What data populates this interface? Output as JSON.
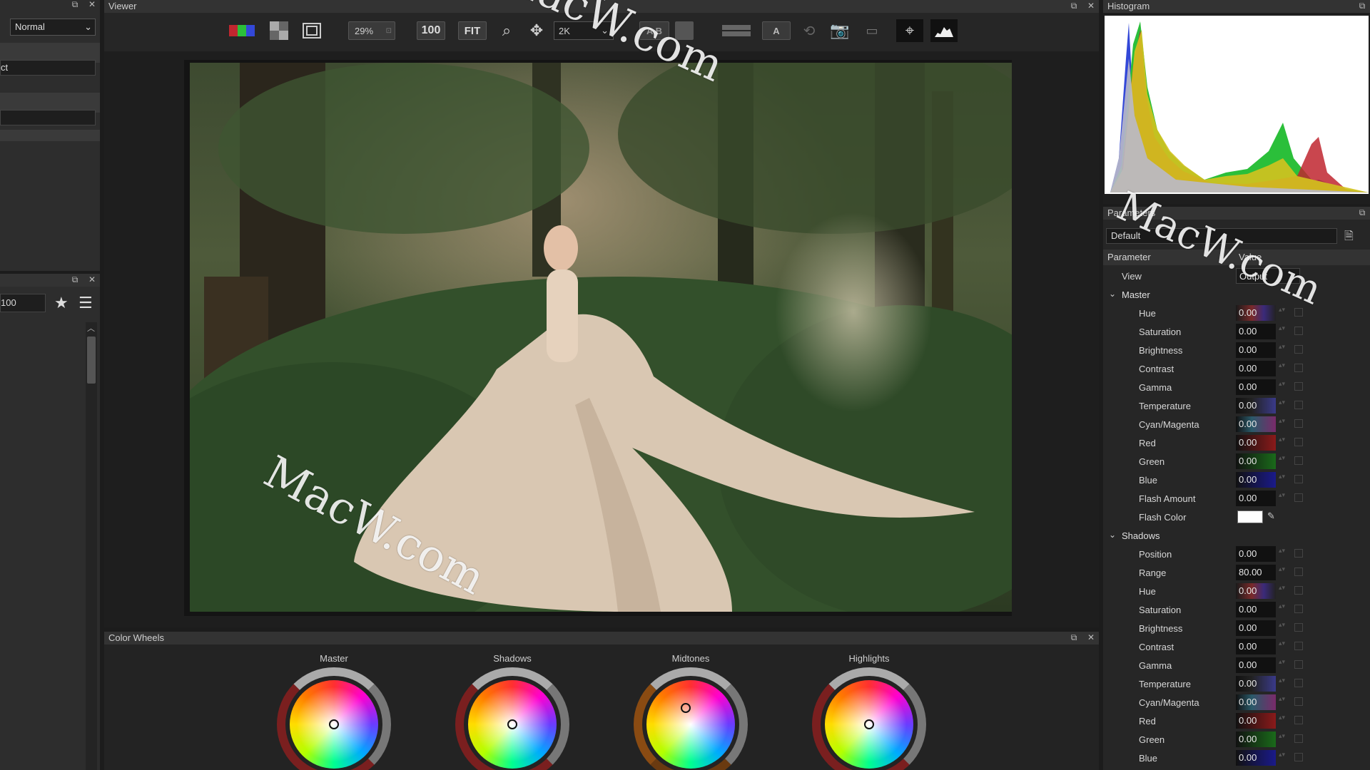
{
  "left_panel": {
    "blend_mode": "Normal",
    "field_text": "ct",
    "second_field": "",
    "rating_value": "100"
  },
  "viewer": {
    "title": "Viewer",
    "zoom": "29%",
    "btn_100": "100",
    "btn_fit": "FIT",
    "resolution": "2K",
    "ab_label": "A B",
    "a_label": "A"
  },
  "color_wheels": {
    "title": "Color Wheels",
    "wheels": [
      {
        "label": "Master"
      },
      {
        "label": "Shadows"
      },
      {
        "label": "Midtones"
      },
      {
        "label": "Highlights"
      }
    ]
  },
  "histogram": {
    "title": "Histogram"
  },
  "parameters": {
    "title": "Parameters",
    "preset": "Default",
    "col_parameter": "Parameter",
    "col_value": "Value",
    "view_label": "View",
    "view_value": "Output",
    "master_title": "Master",
    "master": [
      {
        "label": "Hue",
        "value": "0.00"
      },
      {
        "label": "Saturation",
        "value": "0.00"
      },
      {
        "label": "Brightness",
        "value": "0.00"
      },
      {
        "label": "Contrast",
        "value": "0.00"
      },
      {
        "label": "Gamma",
        "value": "0.00"
      },
      {
        "label": "Temperature",
        "value": "0.00"
      },
      {
        "label": "Cyan/Magenta",
        "value": "0.00"
      },
      {
        "label": "Red",
        "value": "0.00"
      },
      {
        "label": "Green",
        "value": "0.00"
      },
      {
        "label": "Blue",
        "value": "0.00"
      },
      {
        "label": "Flash Amount",
        "value": "0.00"
      }
    ],
    "flash_color_label": "Flash Color",
    "shadows_title": "Shadows",
    "shadows": [
      {
        "label": "Position",
        "value": "0.00"
      },
      {
        "label": "Range",
        "value": "80.00"
      },
      {
        "label": "Hue",
        "value": "0.00"
      },
      {
        "label": "Saturation",
        "value": "0.00"
      },
      {
        "label": "Brightness",
        "value": "0.00"
      },
      {
        "label": "Contrast",
        "value": "0.00"
      },
      {
        "label": "Gamma",
        "value": "0.00"
      },
      {
        "label": "Temperature",
        "value": "0.00"
      },
      {
        "label": "Cyan/Magenta",
        "value": "0.00"
      },
      {
        "label": "Red",
        "value": "0.00"
      },
      {
        "label": "Green",
        "value": "0.00"
      },
      {
        "label": "Blue",
        "value": "0.00"
      }
    ]
  },
  "watermark": "MacW.com",
  "colors": {
    "accent_red": "#c0262f",
    "accent_green": "#2bbf3a",
    "accent_blue": "#3348d8"
  }
}
